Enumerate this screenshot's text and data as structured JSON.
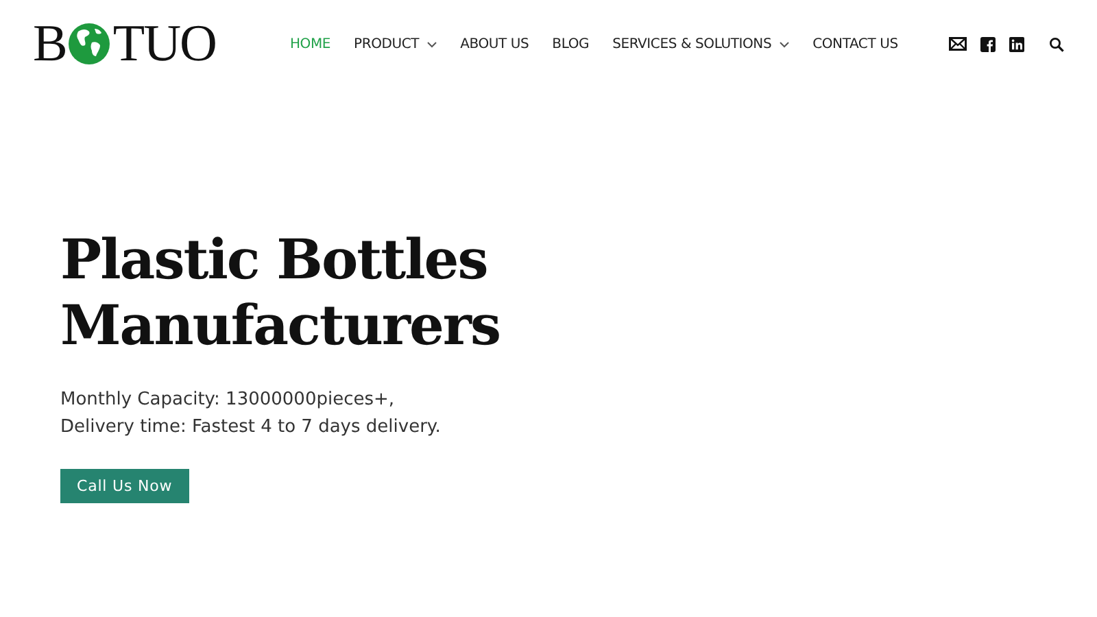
{
  "logo": {
    "before": "B",
    "after": "TUO"
  },
  "nav": [
    {
      "label": "HOME",
      "selected": true,
      "dropdown": false
    },
    {
      "label": "PRODUCT",
      "selected": false,
      "dropdown": true
    },
    {
      "label": "ABOUT US",
      "selected": false,
      "dropdown": false
    },
    {
      "label": "BLOG",
      "selected": false,
      "dropdown": false
    },
    {
      "label": "SERVICES & SOLUTIONS",
      "selected": false,
      "dropdown": true
    },
    {
      "label": "CONTACT US",
      "selected": false,
      "dropdown": false
    }
  ],
  "social": [
    {
      "kind": "mail"
    },
    {
      "kind": "facebook"
    },
    {
      "kind": "linkedin"
    }
  ],
  "hero": {
    "title_lines": [
      "Plastic Bottles",
      "Manufacturers"
    ],
    "description_lines": [
      "Monthly Capacity: 13000000pieces+,",
      "Delivery time: Fastest 4 to 7 days delivery."
    ],
    "button": "Call Us Now"
  }
}
